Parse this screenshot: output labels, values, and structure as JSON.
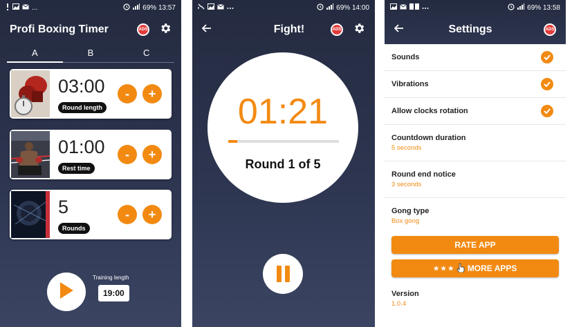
{
  "colors": {
    "accent": "#f28a12",
    "dark": "#2d3550",
    "noads": "#e23b3b"
  },
  "screen1": {
    "status": {
      "left": "...",
      "right": "69% 13:57"
    },
    "title": "Profi Boxing Timer",
    "tabs": [
      "A",
      "B",
      "C"
    ],
    "active_tab": "A",
    "cards": [
      {
        "value": "03:00",
        "label": "Round length"
      },
      {
        "value": "01:00",
        "label": "Rest time"
      },
      {
        "value": "5",
        "label": "Rounds"
      }
    ],
    "minus": "-",
    "plus": "+",
    "training_label": "Training length",
    "training_value": "19:00"
  },
  "screen2": {
    "status": {
      "left": "",
      "right": "69% 14:00"
    },
    "title": "Fight!",
    "timer": "01:21",
    "progress": 0.08,
    "round_text": "Round 1 of 5"
  },
  "screen3": {
    "status": {
      "left": "",
      "right": "69% 13:58"
    },
    "title": "Settings",
    "toggles": [
      {
        "label": "Sounds",
        "checked": true
      },
      {
        "label": "Vibrations",
        "checked": true
      },
      {
        "label": "Allow clocks rotation",
        "checked": true
      }
    ],
    "options": [
      {
        "label": "Countdown duration",
        "value": "5 seconds"
      },
      {
        "label": "Round end notice",
        "value": "3 seconds"
      },
      {
        "label": "Gong type",
        "value": "Box gong"
      }
    ],
    "rate_app": "RATE APP",
    "more_apps": "MORE APPS",
    "more_apps_stars": "★ ★ ★",
    "version_label": "Version",
    "version_value": "1.0.4"
  }
}
